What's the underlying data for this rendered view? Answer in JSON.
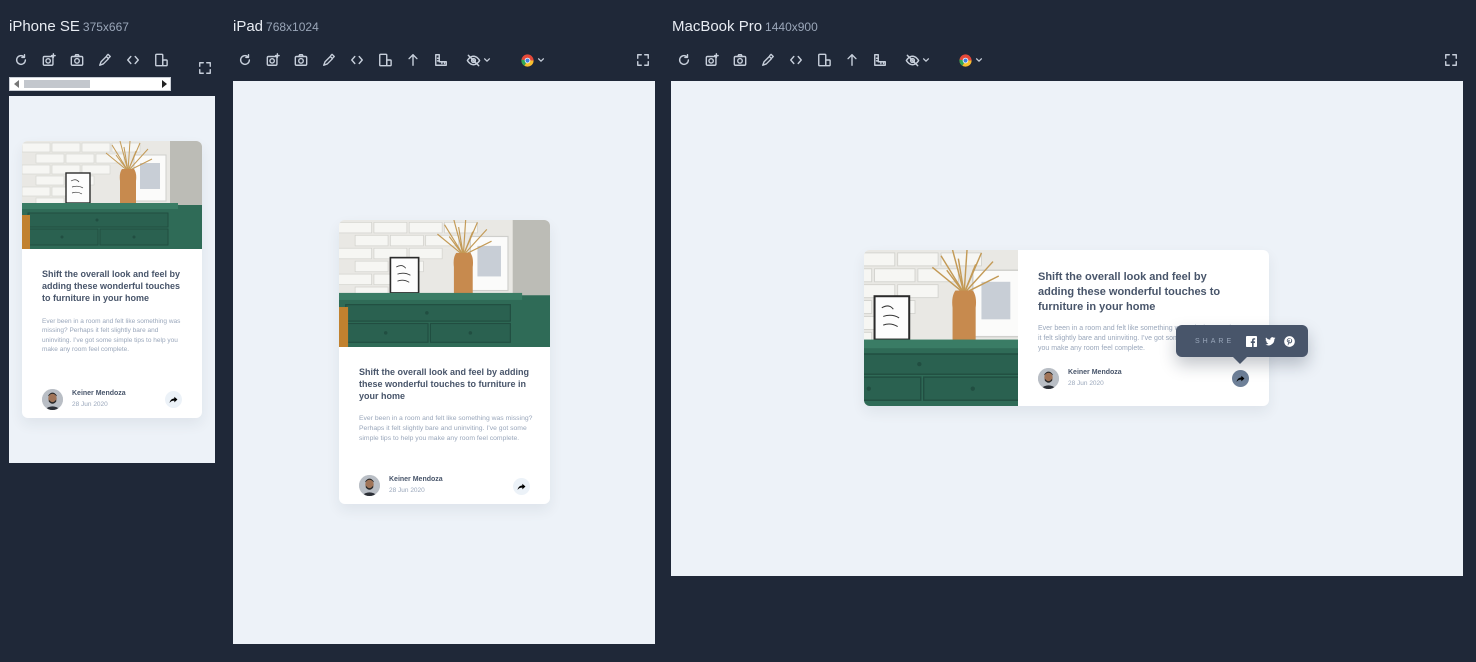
{
  "devices": [
    {
      "name": "iPhone SE",
      "size": "375x667"
    },
    {
      "name": "iPad",
      "size": "768x1024"
    },
    {
      "name": "MacBook Pro",
      "size": "1440x900"
    }
  ],
  "toolbar": {
    "icons": [
      "refresh-icon",
      "screenshot-icon",
      "camera-icon",
      "eyedropper-icon",
      "code-icon",
      "rotate-device-icon",
      "scroll-up-icon",
      "ruler-icon",
      "hide-icon",
      "chrome-icon",
      "fullscreen-icon"
    ]
  },
  "card": {
    "title": "Shift the overall look and feel by adding these wonderful touches to furniture in your home",
    "description": "Ever been in a room and felt like something was missing? Perhaps it felt slightly bare and uninviting. I’ve got some simple tips to help you make any room feel complete.",
    "author": "Keiner Mendoza",
    "date": "28 Jun 2020"
  },
  "share_popup": {
    "label": "SHARE",
    "networks": [
      "facebook-icon",
      "twitter-icon",
      "pinterest-icon"
    ]
  },
  "colors": {
    "app_background": "#1f2838",
    "viewport_background": "#edf2f8",
    "title_text": "#48556a",
    "muted_text": "#9aa7bb",
    "share_button": "#ecf2f8",
    "share_popup": "#48556a"
  }
}
